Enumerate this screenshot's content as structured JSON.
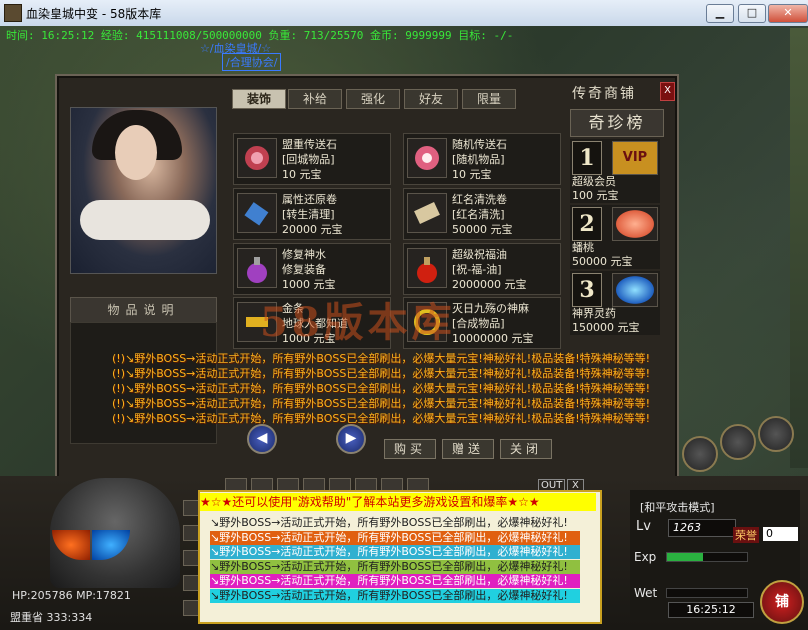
{
  "window": {
    "title": "血染皇城中变 - 58版本库",
    "min": "▁",
    "max": "□",
    "close": "✕"
  },
  "status_bar": {
    "text": "时间: 16:25:12 经验: 415111008/500000000 负重: 713/25570 金币: 9999999 目标: -/-"
  },
  "player": {
    "name": "☆/血染皇城/☆",
    "guild": "/合理协会/"
  },
  "shop": {
    "title": "传奇商铺",
    "close": "X",
    "tabs": [
      "装饰",
      "补给",
      "强化",
      "好友",
      "限量"
    ],
    "desc_title": "物品说明",
    "items": [
      {
        "line1": "盟重传送石",
        "line2": "[回城物品]",
        "line3": "10 元宝"
      },
      {
        "line1": "随机传送石",
        "line2": "[随机物品]",
        "line3": "10 元宝"
      },
      {
        "line1": "属性还原卷",
        "line2": "[转生清理]",
        "line3": "20000 元宝"
      },
      {
        "line1": "红名清洗卷",
        "line2": "[红名清洗]",
        "line3": "50000 元宝"
      },
      {
        "line1": "修复神水",
        "line2": "修复装备",
        "line3": "1000 元宝"
      },
      {
        "line1": "超级祝福油",
        "line2": "[祝-福-油]",
        "line3": "2000000 元宝"
      },
      {
        "line1": "金条",
        "line2": "地球人都知道",
        "line3": "1000 元宝"
      },
      {
        "line1": "灭日九殇の神麻",
        "line2": "[合成物品]",
        "line3": "10000000 元宝"
      }
    ],
    "rare_title": "奇珍榜",
    "rare": [
      {
        "rank": "1",
        "name": "超级会员",
        "price": "100 元宝",
        "badge": "VIP"
      },
      {
        "rank": "2",
        "name": "蟠桃",
        "price": "50000 元宝"
      },
      {
        "rank": "3",
        "name": "神界灵药",
        "price": "150000 元宝"
      }
    ],
    "nav_prev": "◀",
    "nav_next": "▶",
    "buttons": {
      "buy": "购买",
      "gift": "赠送",
      "close": "关闭"
    }
  },
  "watermark": "58版本库",
  "system_messages": [
    "(!)↘野外BOSS→活动正式开始，所有野外BOSS已全部刷出，必爆大量元宝!神秘好礼!极品装备!特殊神秘等等!",
    "(!)↘野外BOSS→活动正式开始，所有野外BOSS已全部刷出，必爆大量元宝!神秘好礼!极品装备!特殊神秘等等!",
    "(!)↘野外BOSS→活动正式开始，所有野外BOSS已全部刷出，必爆大量元宝!神秘好礼!极品装备!特殊神秘等等!",
    "(!)↘野外BOSS→活动正式开始，所有野外BOSS已全部刷出，必爆大量元宝!神秘好礼!极品装备!特殊神秘等等!",
    "(!)↘野外BOSS→活动正式开始，所有野外BOSS已全部刷出，必爆大量元宝!神秘好礼!极品装备!特殊神秘等等!"
  ],
  "chat": {
    "banner": "★☆★还可以使用\"游戏帮助\"了解本站更多游戏设置和爆率★☆★",
    "out_label": "OUT",
    "out_close": "X",
    "lines": [
      {
        "text": "↘野外BOSS→活动正式开始，所有野外BOSS已全部刷出，必爆神秘好礼!",
        "bg": "#f4f0d8",
        "fg": "#202020"
      },
      {
        "text": "↘野外BOSS→活动正式开始，所有野外BOSS已全部刷出，必爆神秘好礼!",
        "bg": "#e06010",
        "fg": "#ffffff"
      },
      {
        "text": "↘野外BOSS→活动正式开始，所有野外BOSS已全部刷出，必爆神秘好礼!",
        "bg": "#30b0d0",
        "fg": "#ffffff"
      },
      {
        "text": "↘野外BOSS→活动正式开始，所有野外BOSS已全部刷出，必爆神秘好礼!",
        "bg": "#90c040",
        "fg": "#202020"
      },
      {
        "text": "↘野外BOSS→活动正式开始，所有野外BOSS已全部刷出，必爆神秘好礼!",
        "bg": "#e020c0",
        "fg": "#ffffff"
      },
      {
        "text": "↘野外BOSS→活动正式开始，所有野外BOSS已全部刷出，必爆神秘好礼!",
        "bg": "#20d0e0",
        "fg": "#202020"
      }
    ]
  },
  "hud": {
    "hp_mp": "HP:205786  MP:17821",
    "location": "盟重省 333:334",
    "attack_mode": "[和平攻击模式]",
    "lv_label": "Lv",
    "lv_value": "1263",
    "honor_label": "荣誉",
    "honor_value": "0",
    "exp_label": "Exp",
    "exp_fraction": 0.45,
    "wet_label": "Wet",
    "clock": "16:25:12",
    "shop_button": "铺"
  }
}
